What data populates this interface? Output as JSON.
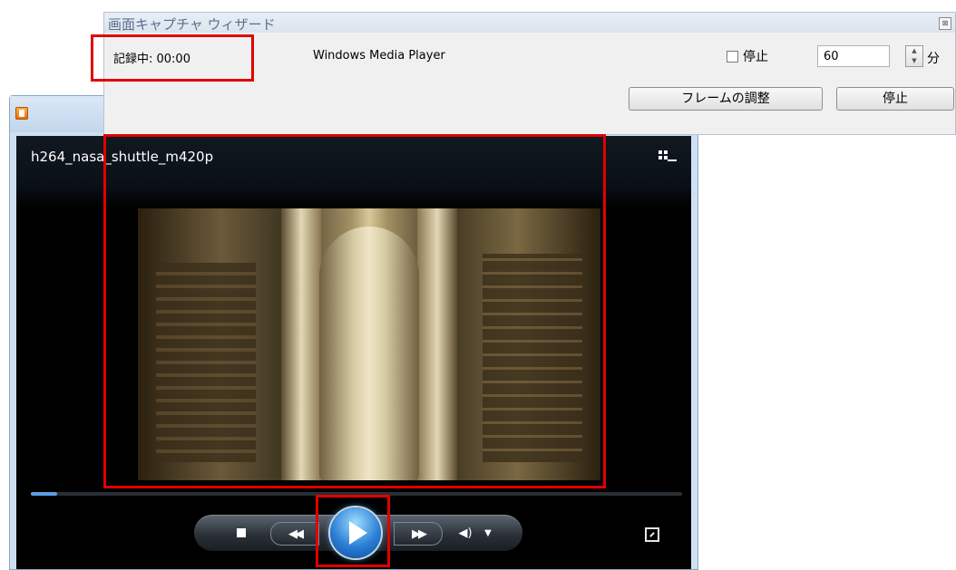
{
  "player": {
    "video_title": "h264_nasa_shuttle_m420p",
    "progress_fraction": 0.04,
    "icons": {
      "app": "media-player-icon",
      "switch_view": "switch-view-icon",
      "stop": "stop-icon",
      "previous": "rewind-icon",
      "play": "play-icon",
      "next": "fast-forward-icon",
      "volume": "volume-icon",
      "volume_dropdown": "chevron-down-icon",
      "fullscreen": "fullscreen-icon"
    },
    "glyphs": {
      "previous": "◀◀",
      "next": "▶▶",
      "volume": "◀)",
      "volume_dropdown": "▼"
    }
  },
  "wizard": {
    "title": "画面キャプチャ ウィザード",
    "close_glyph": "⊠",
    "status": "記録中: 00:00",
    "target_app": "Windows Media Player",
    "stop_after_label": "停止",
    "stop_after_checked": false,
    "minutes_value": "60",
    "minutes_unit": "分",
    "spin_up": "▲",
    "spin_down": "▼",
    "adjust_frame_button": "フレームの調整",
    "stop_button": "停止"
  },
  "highlights": {
    "color": "#e10000"
  }
}
